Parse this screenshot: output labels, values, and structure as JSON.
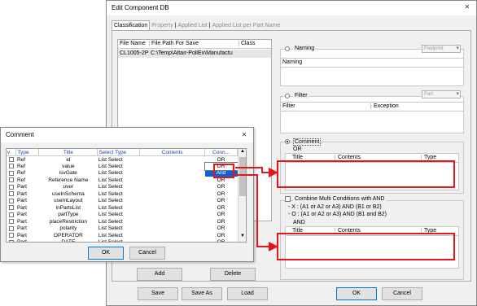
{
  "main": {
    "title": "Edit Component DB",
    "tabs": [
      "Classification",
      "Property",
      "Applied List",
      "Applied List per Part Name"
    ],
    "file_list": {
      "headers": [
        "File Name",
        "File Path For Save",
        "Class"
      ],
      "row": {
        "file_name": "CL1005-2P",
        "file_path": "C:\\Temp\\Altair-PollEx\\Manufactu"
      }
    },
    "naming": {
      "label": "Naming",
      "combo": "Footprint",
      "header": "Naming"
    },
    "filter": {
      "label": "Filter",
      "combo": "Part",
      "headers": [
        "Filter",
        "Exception"
      ]
    },
    "comment": {
      "label": "Comment",
      "op": "OR",
      "headers": [
        "Title",
        "Contents",
        "Type"
      ]
    },
    "combine": {
      "label": "Combine Multi Conditions with AND",
      "x_line": "- X : (A1 or A2 or A3) AND (B1 or B2)",
      "o_line": "- O : (A1 or A2 or A3) AND (B1 and B2)",
      "op": "AND",
      "headers": [
        "Title",
        "Contents",
        "Type"
      ]
    },
    "buttons": {
      "add": "Add",
      "delete": "Delete",
      "save": "Save",
      "save_as": "Save As",
      "load": "Load",
      "ok": "OK",
      "cancel": "Cancel"
    }
  },
  "dialog": {
    "title": "Comment",
    "headers": [
      "v",
      "Type",
      "Title",
      "Select Type",
      "Contents",
      "Conn..."
    ],
    "rows": [
      {
        "type": "Ref",
        "title": "id",
        "select": "List Select",
        "conn": "OR"
      },
      {
        "type": "Ref",
        "title": "value",
        "select": "List Select",
        "conn": "OR"
      },
      {
        "type": "Ref",
        "title": "isvGate",
        "select": "List Select",
        "conn": "And"
      },
      {
        "type": "Ref",
        "title": "Reference Name",
        "select": "List Select",
        "conn": "OR"
      },
      {
        "type": "Part",
        "title": "uver",
        "select": "List Select",
        "conn": "OR"
      },
      {
        "type": "Part",
        "title": "useInSchema",
        "select": "List Select",
        "conn": "OR"
      },
      {
        "type": "Part",
        "title": "useInLayout",
        "select": "List Select",
        "conn": "OR"
      },
      {
        "type": "Part",
        "title": "inPartsList",
        "select": "List Select",
        "conn": "OR"
      },
      {
        "type": "Part",
        "title": "partType",
        "select": "List Select",
        "conn": "OR"
      },
      {
        "type": "Part",
        "title": "placeRestriction",
        "select": "List Select",
        "conn": "OR"
      },
      {
        "type": "Part",
        "title": "polarity",
        "select": "List Select",
        "conn": "OR"
      },
      {
        "type": "Part",
        "title": "OPERATOR",
        "select": "List Select",
        "conn": "OR"
      },
      {
        "type": "Part",
        "title": "DATE",
        "select": "List Select",
        "conn": "OR"
      }
    ],
    "dropdown_options": [
      "OR",
      "And"
    ],
    "ok": "OK",
    "cancel": "Cancel"
  },
  "colors": {
    "highlight": "#e8141b",
    "header_text": "#1a3fb0",
    "selection": "#0a64d8"
  }
}
